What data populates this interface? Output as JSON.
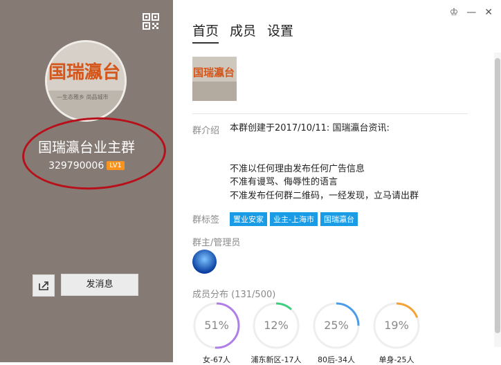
{
  "left": {
    "group_name": "国瑞瀛台业主群",
    "group_id": "329790006",
    "level": "LV1",
    "send_message": "发消息",
    "avatar_text": "国瑞瀛台",
    "avatar_sub": "—生态雅乡 尚品城市"
  },
  "tabs": [
    {
      "label": "首页",
      "active": true
    },
    {
      "label": "成员",
      "active": false
    },
    {
      "label": "设置",
      "active": false
    }
  ],
  "intro": {
    "label": "群介绍",
    "lines": [
      "本群创建于2017/10/11: 国瑞瀛台资讯:",
      "",
      "",
      "不准以任何理由发布任何广告信息",
      "不准有谩骂、侮辱性的语言",
      "不准发布任何群二维码，一经发现，立马请出群"
    ]
  },
  "tags": {
    "label": "群标签",
    "items": [
      "置业安家",
      "业主-上海市",
      "国瑞瀛台"
    ]
  },
  "admins": {
    "label": "群主/管理员"
  },
  "members": {
    "label": "成员分布",
    "count": "(131/500)",
    "stats": [
      {
        "pct": "51%",
        "value": 0.51,
        "caption": "女-67人",
        "color": "#b07ee8"
      },
      {
        "pct": "12%",
        "value": 0.12,
        "caption": "浦东新区-17人",
        "color": "#3ecf7e"
      },
      {
        "pct": "25%",
        "value": 0.25,
        "caption": "80后-34人",
        "color": "#4a9be8"
      },
      {
        "pct": "19%",
        "value": 0.19,
        "caption": "单身-25人",
        "color": "#f5a233"
      }
    ]
  },
  "colors": {
    "left_bg": "#857b74",
    "tag_bg": "#1a9be6",
    "level_bg": "#f7931e",
    "annotation_ring": "#b8101a"
  },
  "icons": [
    "qr-code-icon",
    "share-icon",
    "skin-icon",
    "minimize-icon",
    "close-icon"
  ]
}
